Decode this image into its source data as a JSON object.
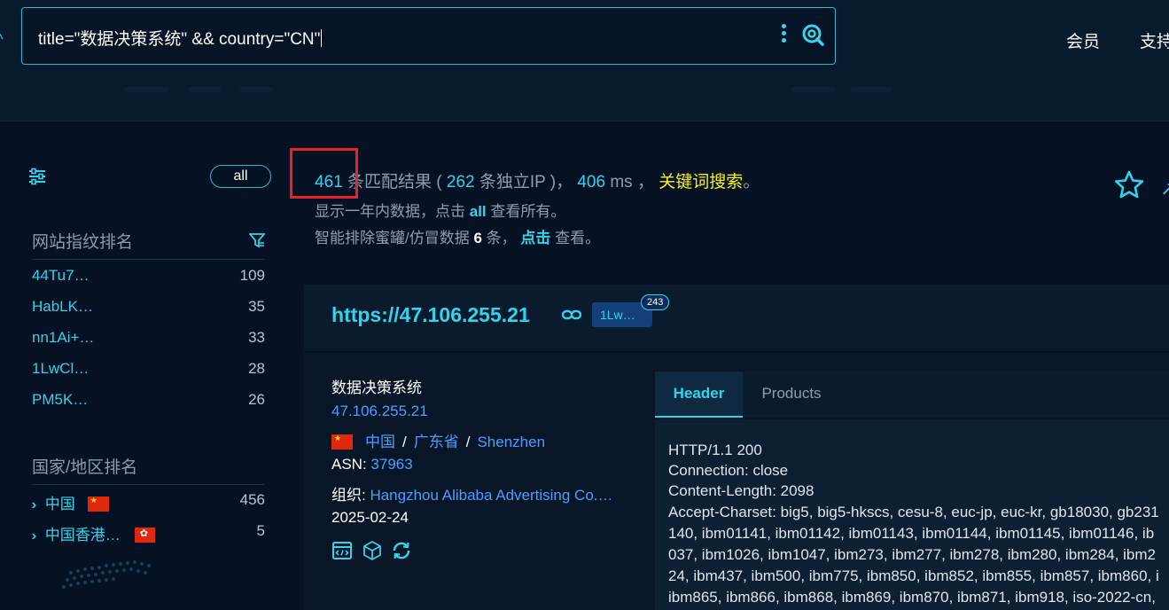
{
  "search": {
    "query": "title=\"数据决策系统\" && country=\"CN\""
  },
  "nav": {
    "member": "会员",
    "support": "支持"
  },
  "sidebar": {
    "all_label": "all",
    "fingerprint_title": "网站指纹排名",
    "fingerprints": [
      {
        "name": "44Tu7…",
        "count": "109"
      },
      {
        "name": "HabLK…",
        "count": "35"
      },
      {
        "name": "nn1Ai+…",
        "count": "33"
      },
      {
        "name": "1LwCl…",
        "count": "28"
      },
      {
        "name": "PM5K…",
        "count": "26"
      }
    ],
    "country_title": "国家/地区排名",
    "countries": [
      {
        "name": "中国",
        "count": "456"
      },
      {
        "name": "中国香港…",
        "count": "5"
      }
    ]
  },
  "summary": {
    "count": "461",
    "text1": " 条匹配结果 ( ",
    "unique_ip": "262",
    "text2": " 条独立IP )， ",
    "ms": "406",
    "text3": " ms ， ",
    "keyword": "关键词搜索",
    "period": "。",
    "line2_a": "显示一年内数据，点击 ",
    "line2_all": "all",
    "line2_b": " 查看所有。",
    "line3_a": "智能排除蜜罐/仿冒数据 ",
    "line3_num": "6",
    "line3_b": " 条， ",
    "line3_click": "点击",
    "line3_c": " 查看。"
  },
  "result": {
    "url": "https://47.106.255.21",
    "tag": "1Lw…",
    "tag_count": "243",
    "title": "数据决策系统",
    "ip": "47.106.255.21",
    "country": "中国",
    "province": "广东省",
    "city": "Shenzhen",
    "asn_label": "ASN: ",
    "asn": "37963",
    "org_label": "组织: ",
    "org": "Hangzhou Alibaba Advertising Co.…",
    "date": "2025-02-24",
    "tabs": {
      "header": "Header",
      "products": "Products"
    },
    "header_lines": [
      "HTTP/1.1 200",
      "Connection: close",
      "Content-Length: 2098",
      "Accept-Charset: big5, big5-hkscs, cesu-8, euc-jp, euc-kr, gb18030, gb231",
      "140, ibm01141, ibm01142, ibm01143, ibm01144, ibm01145, ibm01146, ib",
      "037, ibm1026, ibm1047, ibm273, ibm277, ibm278, ibm280, ibm284, ibm2",
      "24, ibm437, ibm500, ibm775, ibm850, ibm852, ibm855, ibm857, ibm860, i",
      "ibm865, ibm866, ibm868, ibm869, ibm870, ibm871, ibm918, iso-2022-cn,"
    ]
  },
  "colors": {
    "accent": "#31d4ea",
    "link": "#4f9dff",
    "keyword": "#f5f024",
    "annotation": "#e82226"
  }
}
